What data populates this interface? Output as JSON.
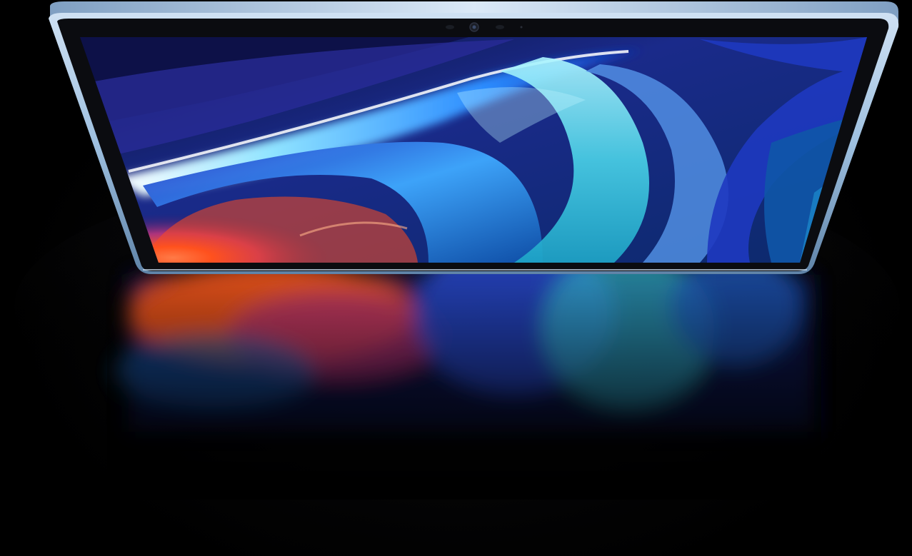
{
  "scene": {
    "subject": "tablet-on-reflective-surface",
    "background_color": "#000000",
    "frame_color": "#8fb3d6",
    "frame_highlight_color": "#d7e6f5",
    "bezel_color": "#0b0c10",
    "wallpaper_colors": [
      "#0b1340",
      "#2a2f9a",
      "#3fb0ff",
      "#9ff2ff",
      "#ff4a1e",
      "#c44a8a",
      "#1b6fd1"
    ],
    "camera_icon": "front-camera-icon",
    "sensor_icons": [
      "sensor-dot-icon",
      "sensor-dot-icon",
      "sensor-dot-icon"
    ]
  }
}
